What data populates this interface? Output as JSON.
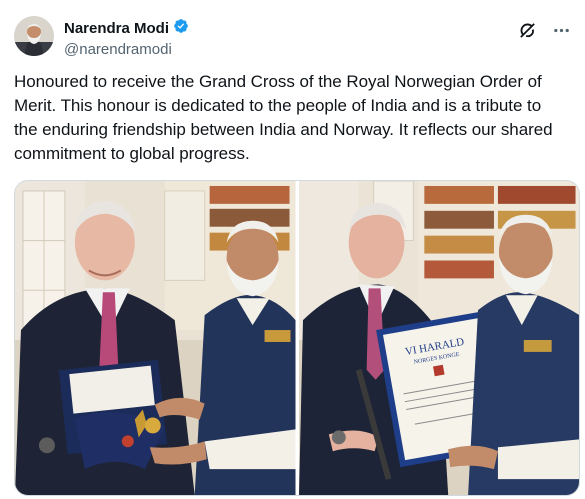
{
  "author": {
    "display_name": "Narendra Modi",
    "handle": "@narendramodi",
    "verified": true
  },
  "post": {
    "text": "Honoured to receive the Grand Cross of the Royal Norwegian Order of Merit. This honour is dedicated to the people of India and is a tribute to the enduring friendship between India and Norway. It reflects our shared commitment to global progress."
  },
  "icons": {
    "verified": "verified-badge-icon",
    "grok": "grok-icon",
    "more": "more-options-icon"
  },
  "media": {
    "certificate_heading": "VI HARALD",
    "certificate_subheading": "NORGES KONGE"
  },
  "colors": {
    "verified_blue": "#1d9bf0",
    "text_primary": "#0f1419",
    "text_secondary": "#536471",
    "border": "#cfd9de"
  }
}
